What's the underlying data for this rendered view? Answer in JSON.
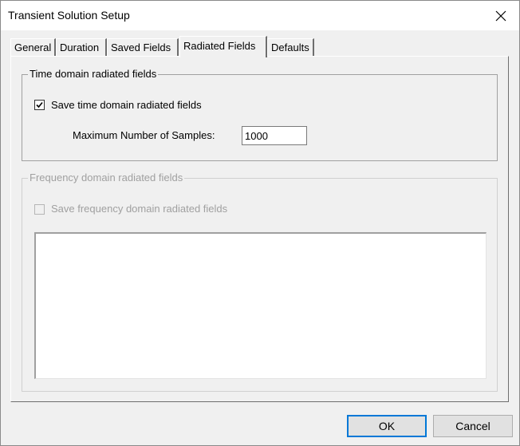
{
  "window": {
    "title": "Transient Solution Setup"
  },
  "tabs": [
    {
      "label": "General"
    },
    {
      "label": "Duration"
    },
    {
      "label": "Saved Fields"
    },
    {
      "label": "Radiated Fields",
      "active": true
    },
    {
      "label": "Defaults"
    }
  ],
  "time_domain": {
    "group_title": "Time domain radiated fields",
    "save_checkbox_label": "Save time domain radiated fields",
    "save_checked": true,
    "max_samples_label": "Maximum Number of Samples:",
    "max_samples_value": "1000"
  },
  "frequency_domain": {
    "group_title": "Frequency domain radiated fields",
    "save_checkbox_label": "Save frequency domain radiated fields",
    "save_checked": false,
    "enabled": false
  },
  "buttons": {
    "ok_label": "OK",
    "cancel_label": "Cancel"
  },
  "icons": {
    "close": "close-icon",
    "check": "checkmark-icon"
  },
  "colors": {
    "window_bg": "#f0f0f0",
    "titlebar_bg": "#ffffff",
    "default_button_border": "#0078d7",
    "disabled_text": "#a0a0a0"
  }
}
